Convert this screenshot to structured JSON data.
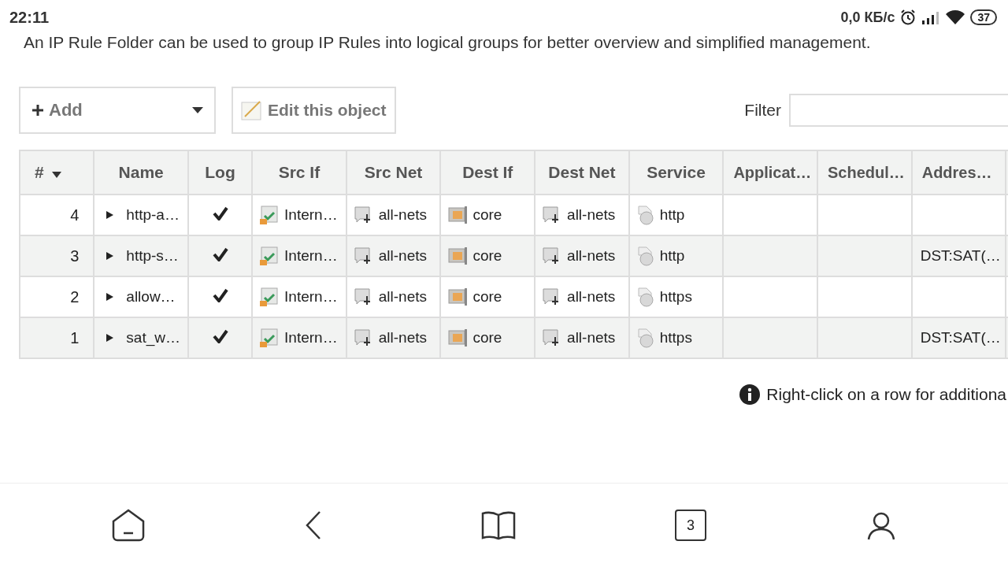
{
  "status_bar": {
    "time": "22:11",
    "speed": "0,0 КБ/с",
    "battery": "37"
  },
  "description": "An IP Rule Folder can be used to group IP Rules into logical groups for better overview and simplified management.",
  "toolbar": {
    "add_button": "Add",
    "edit_button": "Edit this object",
    "filter_label": "Filter"
  },
  "table": {
    "columns": [
      {
        "label": "#",
        "kind": "number",
        "sorted": true
      },
      {
        "label": "Name",
        "kind": "expand",
        "sorted": false
      },
      {
        "label": "Log",
        "kind": "check",
        "sorted": false
      },
      {
        "label": "Src If",
        "kind": "interface",
        "sorted": false
      },
      {
        "label": "Src Net",
        "kind": "network",
        "sorted": false
      },
      {
        "label": "Dest If",
        "kind": "core",
        "sorted": false
      },
      {
        "label": "Dest Net",
        "kind": "network",
        "sorted": false
      },
      {
        "label": "Service",
        "kind": "service",
        "sorted": false
      },
      {
        "label": "Applicat…",
        "kind": "text",
        "sorted": false
      },
      {
        "label": "Schedul…",
        "kind": "text",
        "sorted": false
      },
      {
        "label": "Addres…",
        "kind": "text",
        "sorted": false
      }
    ],
    "rows": [
      {
        "number": "4",
        "name": "http-a…",
        "expanded": false,
        "log": true,
        "src_if": "Intern…",
        "src_net": "all-nets",
        "dest_if": "core",
        "dest_net": "all-nets",
        "service": "http"
      },
      {
        "number": "3",
        "name": "http-s…",
        "expanded": false,
        "log": true,
        "src_if": "Intern…",
        "src_net": "all-nets",
        "dest_if": "core",
        "dest_net": "all-nets",
        "service": "http",
        "address": "DST:SAT(…"
      },
      {
        "number": "2",
        "name": "allow…",
        "expanded": false,
        "log": true,
        "src_if": "Intern…",
        "src_net": "all-nets",
        "dest_if": "core",
        "dest_net": "all-nets",
        "service": "https"
      },
      {
        "number": "1",
        "name": "sat_w…",
        "expanded": false,
        "log": true,
        "src_if": "Intern…",
        "src_net": "all-nets",
        "dest_if": "core",
        "dest_net": "all-nets",
        "service": "https",
        "address": "DST:SAT(…"
      }
    ]
  },
  "hint": "Right-click on a row for additiona",
  "nav_bar": {
    "tabs_count": "3"
  }
}
